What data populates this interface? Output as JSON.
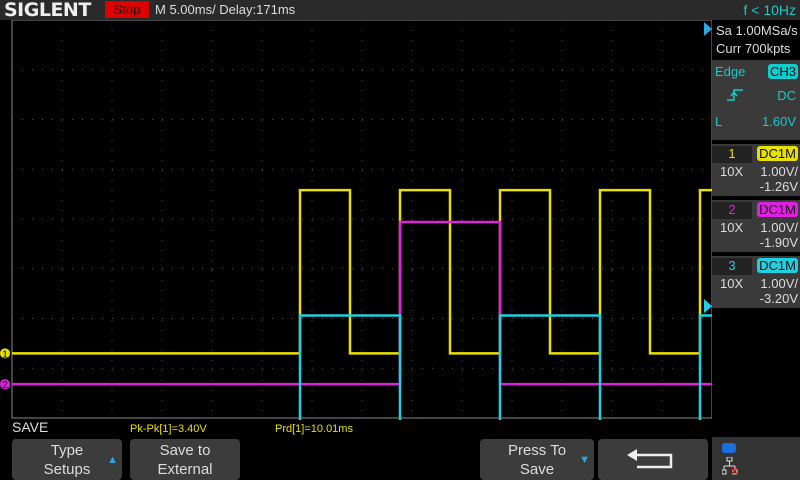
{
  "header": {
    "logo": "SIGLENT",
    "status": "Stop",
    "timebase": "M 5.00ms/ Delay:171ms",
    "frequency": "f < 10Hz"
  },
  "acquisition": {
    "sample_rate": "Sa 1.00MSa/s",
    "memory": "Curr 700kpts"
  },
  "trigger": {
    "type": "Edge",
    "source": "CH3",
    "slope_icon": "rising-edge-icon",
    "coupling": "DC",
    "level_label": "L",
    "level": "1.60V"
  },
  "channels": [
    {
      "num": "1",
      "coupling": "DC1M",
      "probe": "10X",
      "scale": "1.00V/",
      "offset": "-1.26V",
      "color": "#e8e000"
    },
    {
      "num": "2",
      "coupling": "DC1M",
      "probe": "10X",
      "scale": "1.00V/",
      "offset": "-1.90V",
      "color": "#e020e0"
    },
    {
      "num": "3",
      "coupling": "DC1M",
      "probe": "10X",
      "scale": "1.00V/",
      "offset": "-3.20V",
      "color": "#20d0e0"
    }
  ],
  "menu_title": "SAVE",
  "measurements": [
    {
      "text": "Pk-Pk[1]=3.40V"
    },
    {
      "text": "Prd[1]=10.01ms"
    }
  ],
  "softkeys": {
    "type_line1": "Type",
    "type_line2": "Setups",
    "save_to_line1": "Save to",
    "save_to_line2": "External",
    "press_line1": "Press To",
    "press_line2": "Save"
  },
  "waveform_data": {
    "time_divisions": 14,
    "ch1": {
      "low_div": -2.7,
      "high_div": 0.58,
      "edges_div": [
        5.76,
        6.76,
        7.76,
        8.76,
        9.76,
        10.76,
        11.76,
        12.76,
        13.76
      ],
      "initial": "low"
    },
    "ch2": {
      "low_div": -3.32,
      "high_div": -0.06,
      "edges_div": [
        7.76,
        9.76
      ],
      "initial": "low"
    },
    "ch3": {
      "low_div": -5.2,
      "high_div": -1.94,
      "edges_div": [
        5.76,
        7.76,
        9.76,
        11.76,
        13.76
      ],
      "initial": "low"
    }
  }
}
